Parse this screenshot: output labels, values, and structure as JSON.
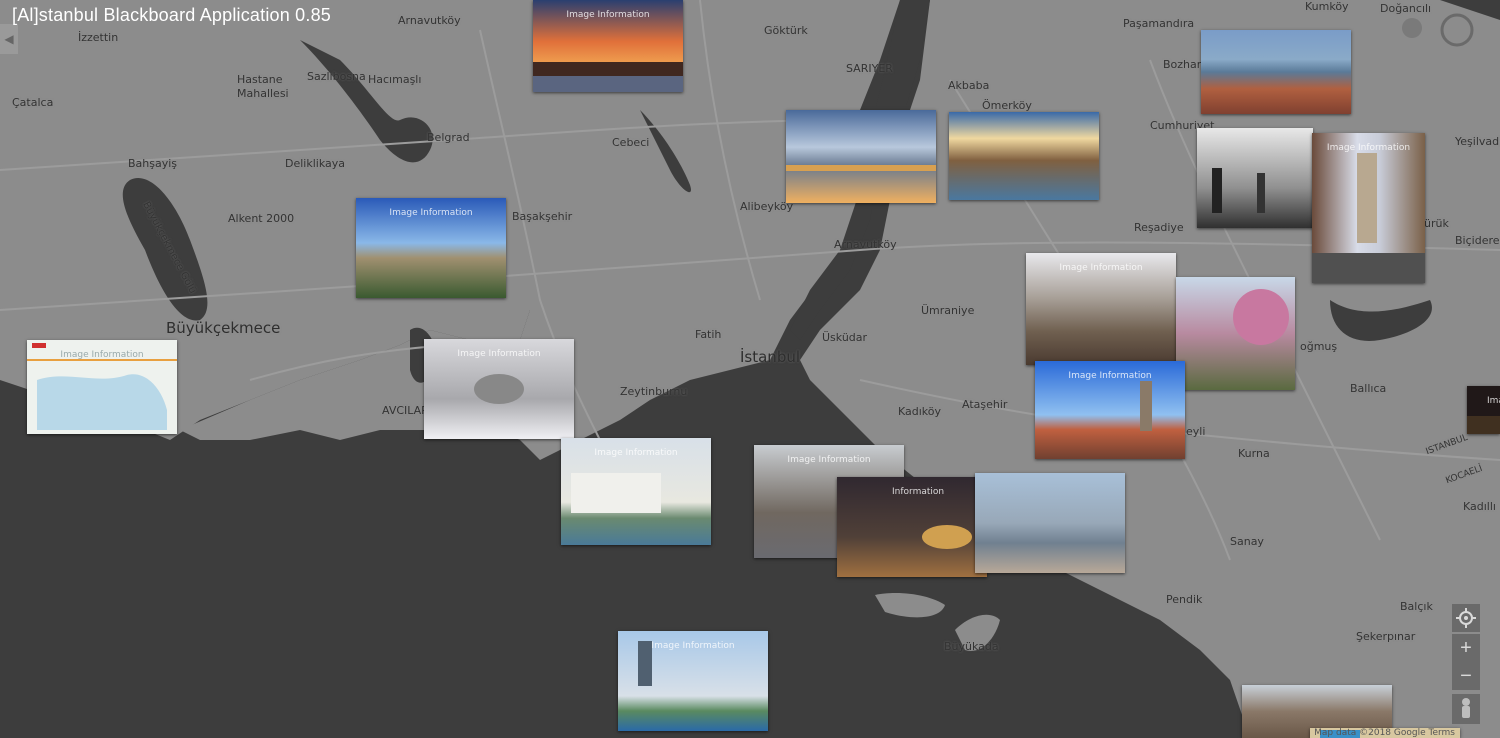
{
  "app": {
    "title": "[Al]stanbul Blackboard Application 0.85"
  },
  "map": {
    "land_color": "#8c8c8c",
    "water_color": "#3d3d3d",
    "road_color": "#9a9a9a",
    "labels": [
      {
        "id": "arnavutkoy",
        "text": "Arnavutköy"
      },
      {
        "id": "izzettin",
        "text": "İzzettin"
      },
      {
        "id": "catalca",
        "text": "Çatalca"
      },
      {
        "id": "hastane",
        "text": "Hastane Mahallesi"
      },
      {
        "id": "sazlibosna",
        "text": "Sazlıbosna"
      },
      {
        "id": "hacimasli",
        "text": "Hacımaşlı"
      },
      {
        "id": "belgrad",
        "text": "Belgrad"
      },
      {
        "id": "cebeci",
        "text": "Cebeci"
      },
      {
        "id": "gokturk",
        "text": "Göktürk"
      },
      {
        "id": "bahsayis",
        "text": "Bahşayiş"
      },
      {
        "id": "deliklikaya",
        "text": "Deliklikaya"
      },
      {
        "id": "alkent",
        "text": "Alkent 2000"
      },
      {
        "id": "basaksehir",
        "text": "Başakşehir"
      },
      {
        "id": "alibeykoy",
        "text": "Alibeyköy"
      },
      {
        "id": "amavutkoy",
        "text": "Arnavutköy"
      },
      {
        "id": "buyukcekmece",
        "text": "Büyükçekmece"
      },
      {
        "id": "buyukcekmece_golu",
        "text": "Büyükçekmece Gölü"
      },
      {
        "id": "avcilar",
        "text": "AVCILAR"
      },
      {
        "id": "fatih",
        "text": "Fatih"
      },
      {
        "id": "istanbul",
        "text": "İstanbul"
      },
      {
        "id": "uskudar",
        "text": "Üsküdar"
      },
      {
        "id": "umraniye",
        "text": "Ümraniye"
      },
      {
        "id": "zeytinburnu",
        "text": "Zeytinburnu"
      },
      {
        "id": "kadikoy",
        "text": "Kadıköy"
      },
      {
        "id": "atasehir",
        "text": "Ataşehir"
      },
      {
        "id": "sariyer",
        "text": "SARIYER"
      },
      {
        "id": "akbaba",
        "text": "Akbaba"
      },
      {
        "id": "omerkoy",
        "text": "Ömerköy"
      },
      {
        "id": "cumhuriyet",
        "text": "Cumhuriyet"
      },
      {
        "id": "resadiye",
        "text": "Reşadiye"
      },
      {
        "id": "pasamandira",
        "text": "Paşamandıra"
      },
      {
        "id": "bozhane",
        "text": "Bozhane"
      },
      {
        "id": "dogancili",
        "text": "Doğancılı"
      },
      {
        "id": "kumkoy",
        "text": "Kumköy"
      },
      {
        "id": "yesilvadi",
        "text": "Yeşilvadi"
      },
      {
        "id": "bicidere",
        "text": "Biçidere"
      },
      {
        "id": "ballica",
        "text": "Ballıca"
      },
      {
        "id": "istanbul2",
        "text": "ISTANBUL"
      },
      {
        "id": "kocaeli",
        "text": "KOCAELİ"
      },
      {
        "id": "kadilli",
        "text": "Kadıllı"
      },
      {
        "id": "kurna",
        "text": "Kurna"
      },
      {
        "id": "sanay",
        "text": "Sanay"
      },
      {
        "id": "baliksi",
        "text": "Balçık"
      },
      {
        "id": "pendik",
        "text": "Pendik"
      },
      {
        "id": "sekerpinar",
        "text": "Şekerpınar"
      },
      {
        "id": "buyukada",
        "text": "Büyükada"
      },
      {
        "id": "eyeli",
        "text": "eyli"
      },
      {
        "id": "mirtuk",
        "text": "ürük"
      },
      {
        "id": "dogus",
        "text": "oğmuş"
      }
    ],
    "attribution": "Map data ©2018 Google   Terms"
  },
  "thumbnails": [
    {
      "id": "galata-bridge-sunset",
      "caption": "Image Information"
    },
    {
      "id": "chain-bridge",
      "caption": ""
    },
    {
      "id": "istanbul-skyline",
      "caption": ""
    },
    {
      "id": "golden-horn-aerial",
      "caption": ""
    },
    {
      "id": "fishermen-bw",
      "caption": ""
    },
    {
      "id": "galata-street",
      "caption": "Image Information"
    },
    {
      "id": "panorama-city",
      "caption": "Image Information"
    },
    {
      "id": "suleymaniye",
      "caption": "Image Information"
    },
    {
      "id": "blossom-mosque",
      "caption": ""
    },
    {
      "id": "map-thumb",
      "caption": "Image Information"
    },
    {
      "id": "blue-mosque-snow",
      "caption": "Image Information"
    },
    {
      "id": "galata-tower",
      "caption": "Image Information"
    },
    {
      "id": "dark-edge",
      "caption": "Ima"
    },
    {
      "id": "haydarpasa",
      "caption": "Image Information"
    },
    {
      "id": "blue-mosque-crowd",
      "caption": "Image Information"
    },
    {
      "id": "night-mosque",
      "caption": "Information"
    },
    {
      "id": "golden-horn-view",
      "caption": ""
    },
    {
      "id": "ortakoy",
      "caption": "Image Information"
    },
    {
      "id": "hillside-houses",
      "caption": ""
    },
    {
      "id": "tram-thumb",
      "caption": ""
    }
  ],
  "controls": {
    "locate_icon": "crosshair-icon",
    "zoom_in": "+",
    "zoom_out": "−",
    "pegman_icon": "pegman-icon"
  }
}
